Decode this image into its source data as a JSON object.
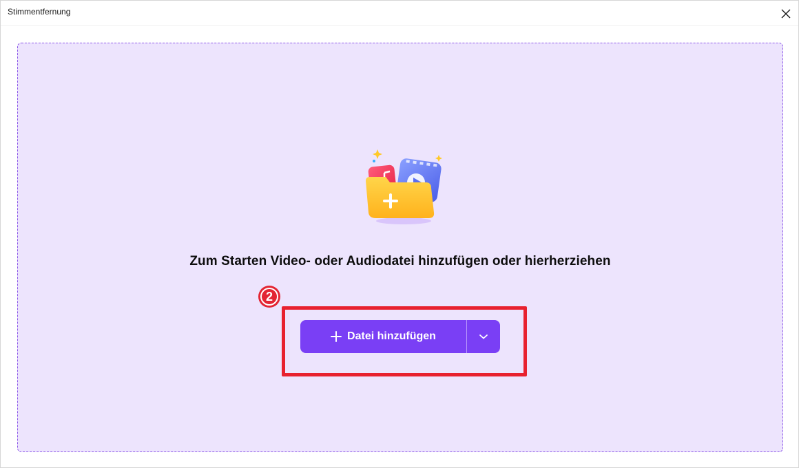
{
  "window": {
    "title": "Stimmentfernung"
  },
  "dropzone": {
    "hint": "Zum Starten Video- oder Audiodatei hinzufügen oder hierherziehen",
    "step_badge": "2",
    "add_button_label": "Datei hinzufügen"
  },
  "icons": [
    "close-icon",
    "media-folder-icon",
    "plus-icon",
    "chevron-down-icon"
  ],
  "colors": {
    "dropzone_bg": "#ede4fd",
    "dropzone_border": "#8a55e8",
    "button": "#7a3ff5",
    "highlight": "#e8212f"
  }
}
